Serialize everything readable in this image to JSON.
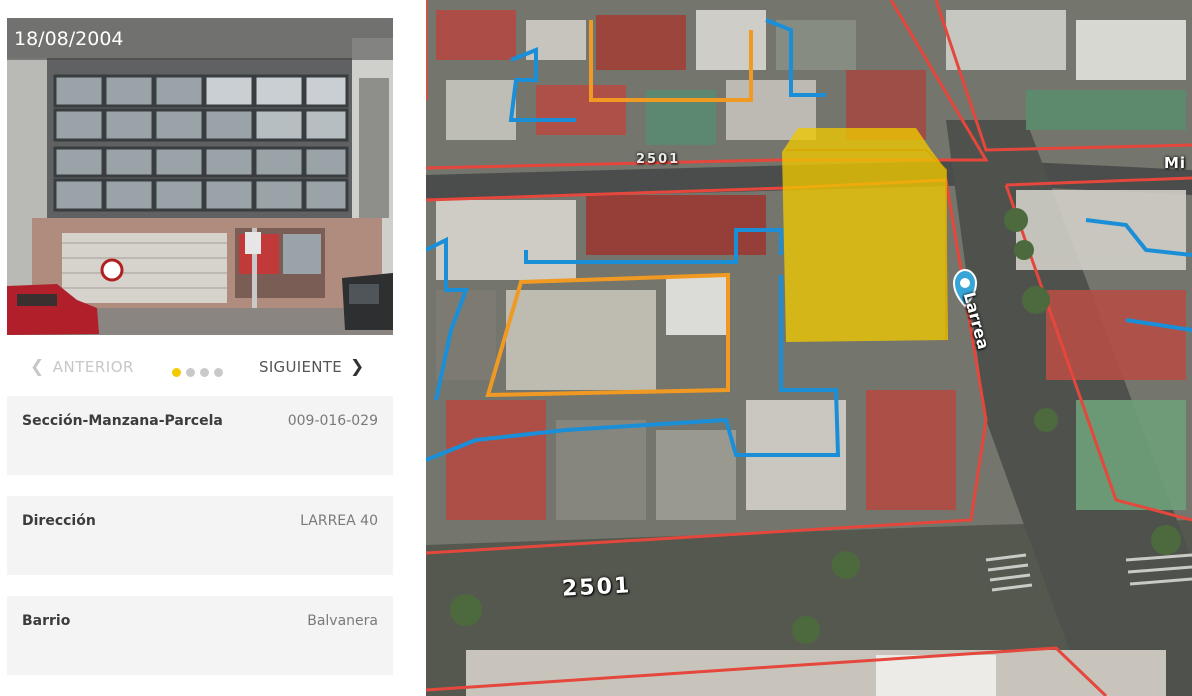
{
  "photo": {
    "date": "18/08/2004"
  },
  "pager": {
    "prev_label": "ANTERIOR",
    "next_label": "SIGUIENTE",
    "total_dots": 4,
    "active_dot": 1
  },
  "info": [
    {
      "label": "Sección-Manzana-Parcela",
      "value": "009-016-029"
    },
    {
      "label": "Dirección",
      "value": "LARREA 40"
    },
    {
      "label": "Barrio",
      "value": "Balvanera"
    }
  ],
  "map": {
    "block_label_main": "2501",
    "block_label_top": "2501",
    "street_label": "Larrea",
    "street_label_right": "Mi",
    "marker_color": "#37a6d6",
    "selection_color": "#f0c800",
    "block_border_color": "#e6473c",
    "parcel_color_blue": "#1a8fd8",
    "parcel_color_orange": "#f09a23"
  },
  "icons": {
    "prev": "chevron-left-icon",
    "next": "chevron-right-icon",
    "marker": "map-pin-icon"
  }
}
